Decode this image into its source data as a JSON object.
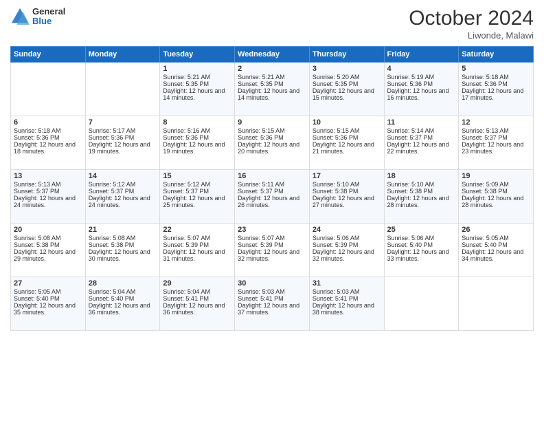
{
  "header": {
    "logo": {
      "general": "General",
      "blue": "Blue"
    },
    "title": "October 2024",
    "location": "Liwonde, Malawi"
  },
  "calendar": {
    "days_of_week": [
      "Sunday",
      "Monday",
      "Tuesday",
      "Wednesday",
      "Thursday",
      "Friday",
      "Saturday"
    ],
    "weeks": [
      [
        {
          "day": "",
          "sunrise": "",
          "sunset": "",
          "daylight": ""
        },
        {
          "day": "",
          "sunrise": "",
          "sunset": "",
          "daylight": ""
        },
        {
          "day": "1",
          "sunrise": "Sunrise: 5:21 AM",
          "sunset": "Sunset: 5:35 PM",
          "daylight": "Daylight: 12 hours and 14 minutes."
        },
        {
          "day": "2",
          "sunrise": "Sunrise: 5:21 AM",
          "sunset": "Sunset: 5:35 PM",
          "daylight": "Daylight: 12 hours and 14 minutes."
        },
        {
          "day": "3",
          "sunrise": "Sunrise: 5:20 AM",
          "sunset": "Sunset: 5:35 PM",
          "daylight": "Daylight: 12 hours and 15 minutes."
        },
        {
          "day": "4",
          "sunrise": "Sunrise: 5:19 AM",
          "sunset": "Sunset: 5:36 PM",
          "daylight": "Daylight: 12 hours and 16 minutes."
        },
        {
          "day": "5",
          "sunrise": "Sunrise: 5:18 AM",
          "sunset": "Sunset: 5:36 PM",
          "daylight": "Daylight: 12 hours and 17 minutes."
        }
      ],
      [
        {
          "day": "6",
          "sunrise": "Sunrise: 5:18 AM",
          "sunset": "Sunset: 5:36 PM",
          "daylight": "Daylight: 12 hours and 18 minutes."
        },
        {
          "day": "7",
          "sunrise": "Sunrise: 5:17 AM",
          "sunset": "Sunset: 5:36 PM",
          "daylight": "Daylight: 12 hours and 19 minutes."
        },
        {
          "day": "8",
          "sunrise": "Sunrise: 5:16 AM",
          "sunset": "Sunset: 5:36 PM",
          "daylight": "Daylight: 12 hours and 19 minutes."
        },
        {
          "day": "9",
          "sunrise": "Sunrise: 5:15 AM",
          "sunset": "Sunset: 5:36 PM",
          "daylight": "Daylight: 12 hours and 20 minutes."
        },
        {
          "day": "10",
          "sunrise": "Sunrise: 5:15 AM",
          "sunset": "Sunset: 5:36 PM",
          "daylight": "Daylight: 12 hours and 21 minutes."
        },
        {
          "day": "11",
          "sunrise": "Sunrise: 5:14 AM",
          "sunset": "Sunset: 5:37 PM",
          "daylight": "Daylight: 12 hours and 22 minutes."
        },
        {
          "day": "12",
          "sunrise": "Sunrise: 5:13 AM",
          "sunset": "Sunset: 5:37 PM",
          "daylight": "Daylight: 12 hours and 23 minutes."
        }
      ],
      [
        {
          "day": "13",
          "sunrise": "Sunrise: 5:13 AM",
          "sunset": "Sunset: 5:37 PM",
          "daylight": "Daylight: 12 hours and 24 minutes."
        },
        {
          "day": "14",
          "sunrise": "Sunrise: 5:12 AM",
          "sunset": "Sunset: 5:37 PM",
          "daylight": "Daylight: 12 hours and 24 minutes."
        },
        {
          "day": "15",
          "sunrise": "Sunrise: 5:12 AM",
          "sunset": "Sunset: 5:37 PM",
          "daylight": "Daylight: 12 hours and 25 minutes."
        },
        {
          "day": "16",
          "sunrise": "Sunrise: 5:11 AM",
          "sunset": "Sunset: 5:37 PM",
          "daylight": "Daylight: 12 hours and 26 minutes."
        },
        {
          "day": "17",
          "sunrise": "Sunrise: 5:10 AM",
          "sunset": "Sunset: 5:38 PM",
          "daylight": "Daylight: 12 hours and 27 minutes."
        },
        {
          "day": "18",
          "sunrise": "Sunrise: 5:10 AM",
          "sunset": "Sunset: 5:38 PM",
          "daylight": "Daylight: 12 hours and 28 minutes."
        },
        {
          "day": "19",
          "sunrise": "Sunrise: 5:09 AM",
          "sunset": "Sunset: 5:38 PM",
          "daylight": "Daylight: 12 hours and 28 minutes."
        }
      ],
      [
        {
          "day": "20",
          "sunrise": "Sunrise: 5:08 AM",
          "sunset": "Sunset: 5:38 PM",
          "daylight": "Daylight: 12 hours and 29 minutes."
        },
        {
          "day": "21",
          "sunrise": "Sunrise: 5:08 AM",
          "sunset": "Sunset: 5:38 PM",
          "daylight": "Daylight: 12 hours and 30 minutes."
        },
        {
          "day": "22",
          "sunrise": "Sunrise: 5:07 AM",
          "sunset": "Sunset: 5:39 PM",
          "daylight": "Daylight: 12 hours and 31 minutes."
        },
        {
          "day": "23",
          "sunrise": "Sunrise: 5:07 AM",
          "sunset": "Sunset: 5:39 PM",
          "daylight": "Daylight: 12 hours and 32 minutes."
        },
        {
          "day": "24",
          "sunrise": "Sunrise: 5:06 AM",
          "sunset": "Sunset: 5:39 PM",
          "daylight": "Daylight: 12 hours and 32 minutes."
        },
        {
          "day": "25",
          "sunrise": "Sunrise: 5:06 AM",
          "sunset": "Sunset: 5:40 PM",
          "daylight": "Daylight: 12 hours and 33 minutes."
        },
        {
          "day": "26",
          "sunrise": "Sunrise: 5:05 AM",
          "sunset": "Sunset: 5:40 PM",
          "daylight": "Daylight: 12 hours and 34 minutes."
        }
      ],
      [
        {
          "day": "27",
          "sunrise": "Sunrise: 5:05 AM",
          "sunset": "Sunset: 5:40 PM",
          "daylight": "Daylight: 12 hours and 35 minutes."
        },
        {
          "day": "28",
          "sunrise": "Sunrise: 5:04 AM",
          "sunset": "Sunset: 5:40 PM",
          "daylight": "Daylight: 12 hours and 36 minutes."
        },
        {
          "day": "29",
          "sunrise": "Sunrise: 5:04 AM",
          "sunset": "Sunset: 5:41 PM",
          "daylight": "Daylight: 12 hours and 36 minutes."
        },
        {
          "day": "30",
          "sunrise": "Sunrise: 5:03 AM",
          "sunset": "Sunset: 5:41 PM",
          "daylight": "Daylight: 12 hours and 37 minutes."
        },
        {
          "day": "31",
          "sunrise": "Sunrise: 5:03 AM",
          "sunset": "Sunset: 5:41 PM",
          "daylight": "Daylight: 12 hours and 38 minutes."
        },
        {
          "day": "",
          "sunrise": "",
          "sunset": "",
          "daylight": ""
        },
        {
          "day": "",
          "sunrise": "",
          "sunset": "",
          "daylight": ""
        }
      ]
    ]
  }
}
